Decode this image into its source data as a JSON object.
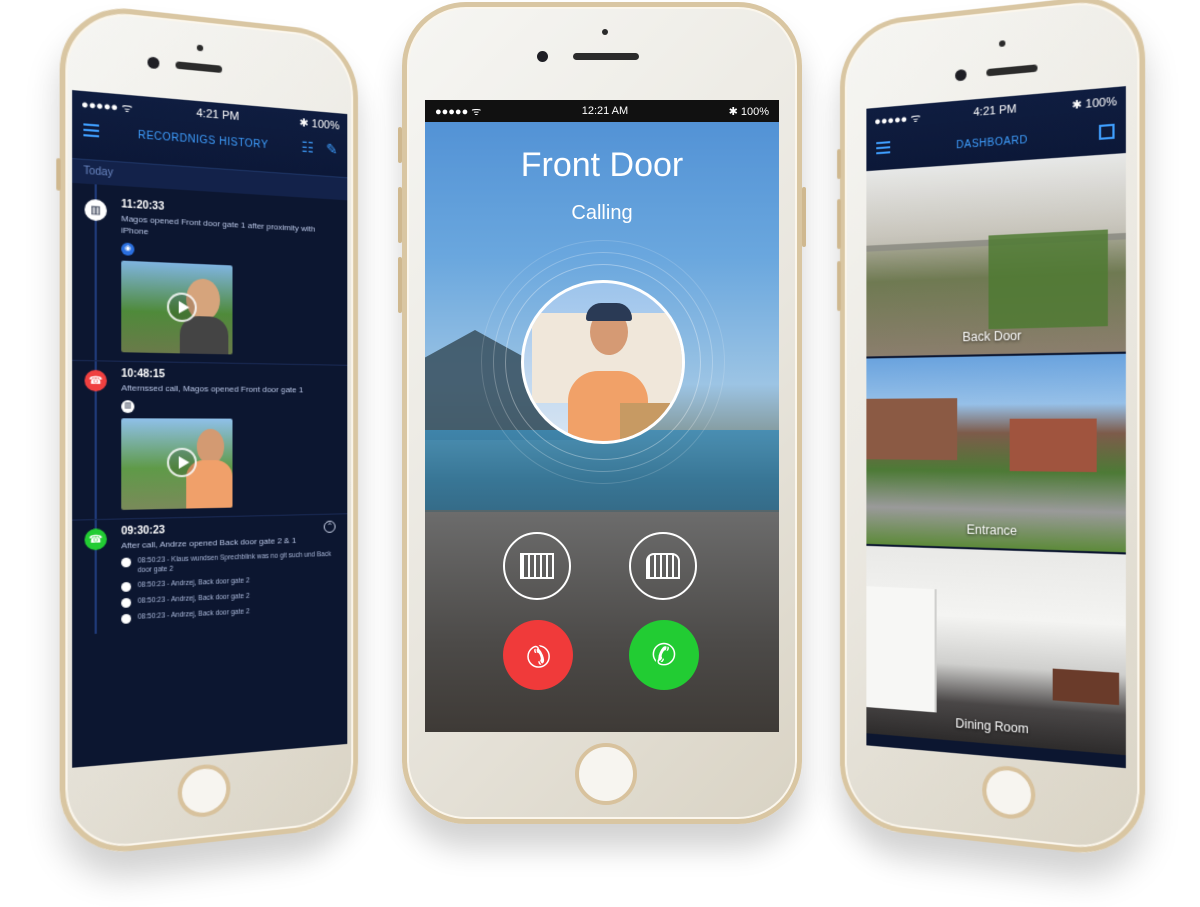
{
  "left_phone": {
    "status": {
      "carrier": "●●●●● ᯤ",
      "time": "4:21 PM",
      "battery": "✱ 100%"
    },
    "header": {
      "title": "RECORDNIGS HISTORY"
    },
    "section": "Today",
    "events": [
      {
        "time": "11:20:33",
        "desc": "Magos opened Front door gate 1 after proximity with iPhone",
        "dot_color": "#ffffff",
        "has_thumb": true
      },
      {
        "time": "10:48:15",
        "desc": "Afternssed call, Magos opened Front door gate 1",
        "dot_color": "#f04040",
        "has_thumb": true
      },
      {
        "time": "09:30:23",
        "desc": "After call, Andrze opened Back door gate 2 & 1",
        "dot_color": "#22cc33",
        "has_thumb": false
      }
    ],
    "sub_entries": [
      "08:50:23 - Klaus wundsen Sprechblink was no git such und Back door gate 2",
      "08:50:23 - Andrzej, Back door gate 2",
      "08:50:23 - Andrzej, Back door gate 2",
      "08:50:23 - Andrzej, Back door gate 2"
    ]
  },
  "center_phone": {
    "status": {
      "carrier": "●●●●● ᯤ",
      "time": "12:21 AM",
      "battery": "✱ 100%"
    },
    "title": "Front Door",
    "subtitle": "Calling",
    "colors": {
      "decline": "#f03a3a",
      "accept": "#22cc33"
    }
  },
  "right_phone": {
    "status": {
      "carrier": "●●●●● ᯤ",
      "time": "4:21 PM",
      "battery": "✱ 100%"
    },
    "header": {
      "title": "DASHBOARD"
    },
    "cameras": [
      "Back Door",
      "Entrance",
      "Dining Room"
    ]
  }
}
